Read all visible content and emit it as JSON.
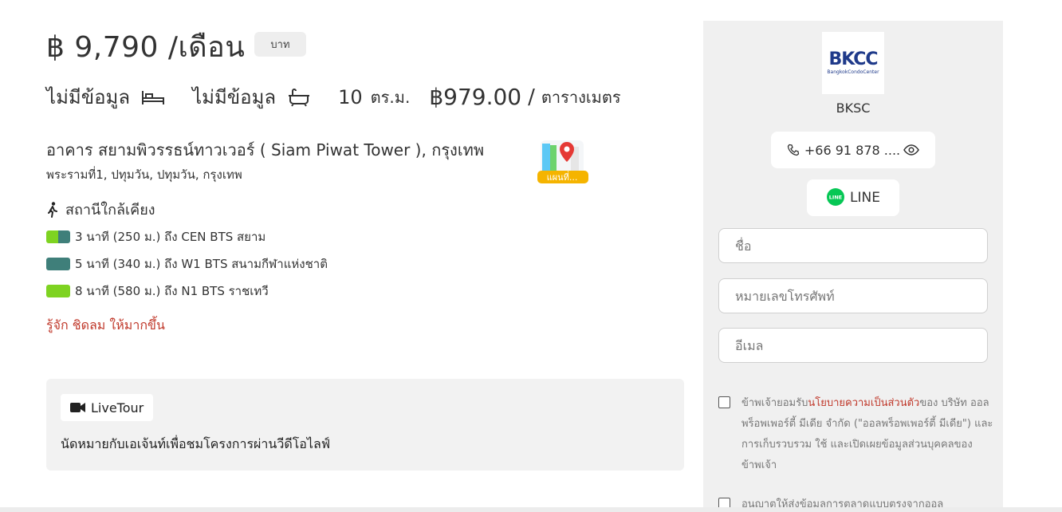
{
  "listing": {
    "price": "฿ 9,790 /เดือน",
    "currency_badge": "บาท",
    "bedrooms": "ไม่มีข้อมูล",
    "bathrooms": "ไม่มีข้อมูล",
    "area_value": "10",
    "area_unit": "ตร.ม.",
    "price_per_sqm": "฿979.00",
    "price_per_sqm_slash": "/",
    "price_per_sqm_unit": "ตารางเมตร",
    "building": "อาคาร สยามพิวรรธน์ทาวเวอร์ ( Siam Piwat Tower ), กรุงเทพ",
    "address": "พระรามที่1, ปทุมวัน, ปทุมวัน, กรุงเทพ",
    "map_label": "แผนที่..."
  },
  "nearby": {
    "title": "สถานีใกล้เคียง",
    "stations": [
      {
        "text": "3 นาที (250 ม.) ถึง CEN BTS สยาม",
        "colors": [
          "#7ed321",
          "#3f7f7a"
        ]
      },
      {
        "text": "5 นาที (340 ม.) ถึง W1 BTS สนามกีฬาแห่งชาติ",
        "colors": [
          "#3f7f7a"
        ]
      },
      {
        "text": "8 นาที (580 ม.) ถึง N1 BTS ราชเทวี",
        "colors": [
          "#7ed321"
        ]
      }
    ]
  },
  "learn_more": "รู้จัก ชิดลม ให้มากขึ้น",
  "livetour": {
    "button_label": "LiveTour",
    "description": "นัดหมายกับเอเจ้นท์เพื่อชมโครงการผ่านวีดีโอไลฟ์"
  },
  "agent": {
    "logo_text": "BKCC",
    "logo_subtext": "BangkokCondoCenter",
    "name": "BKSC",
    "phone": "+66 91 878 ....",
    "line_label": "LINE"
  },
  "form": {
    "name_placeholder": "ชื่อ",
    "phone_placeholder": "หมายเลขโทรศัพท์",
    "email_placeholder": "อีเมล",
    "consent1_prefix": "ข้าพเจ้ายอมรับ",
    "consent1_link": "นโยบายความเป็นส่วนตัว",
    "consent1_suffix": "ของ บริษัท ออลพร็อพเพอร์ตี้ มีเดีย จำกัด (\"ออลพร็อพเพอร์ตี้ มีเดีย\") และการเก็บรวบรวม ใช้ และเปิดเผยข้อมูลส่วนบุคคลของข้าพเจ้า",
    "consent2_text": "อนุญาตให้ส่งข้อมูลการตลาดแบบตรงจากออล"
  },
  "colors": {
    "accent_red": "#c0392b",
    "station_green": "#7ed321",
    "station_teal": "#3f7f7a",
    "line_green": "#06c755",
    "logo_blue": "#1f3a8a"
  }
}
